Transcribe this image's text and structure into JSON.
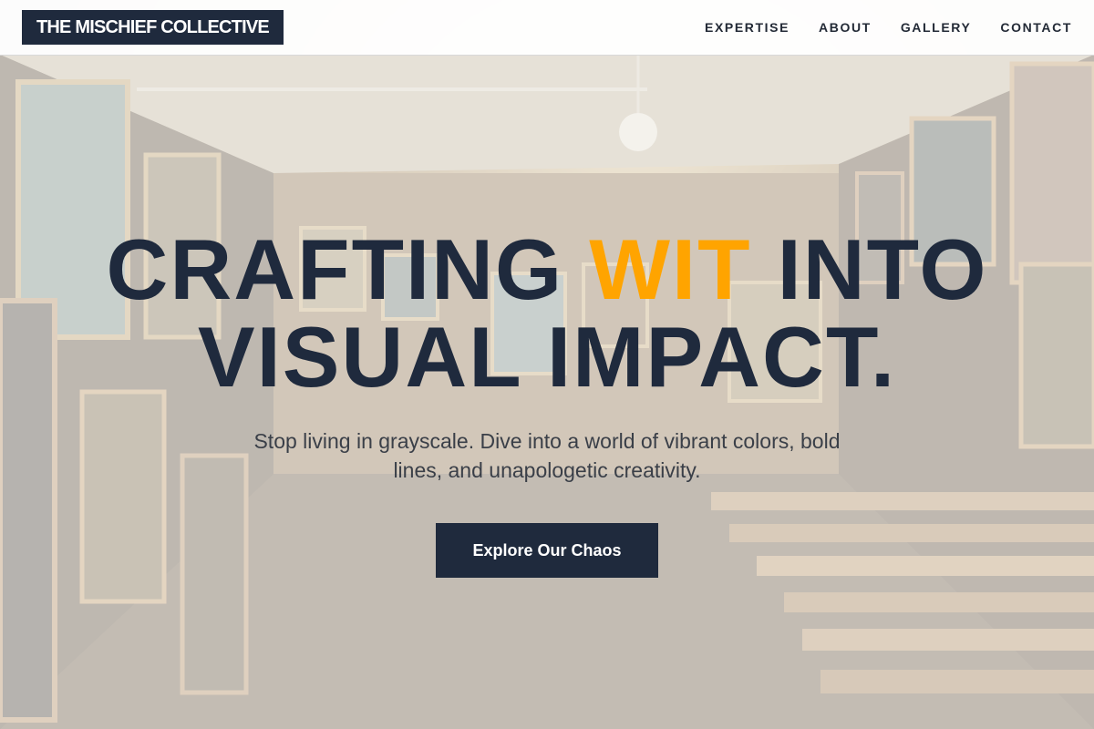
{
  "brand": {
    "name": "THE MISCHIEF COLLECTIVE"
  },
  "nav": {
    "items": [
      {
        "label": "EXPERTISE"
      },
      {
        "label": "ABOUT"
      },
      {
        "label": "GALLERY"
      },
      {
        "label": "CONTACT"
      }
    ]
  },
  "hero": {
    "headline_part1": "CRAFTING ",
    "headline_accent": "WIT",
    "headline_part2": " INTO",
    "headline_line2": "VISUAL IMPACT.",
    "subhead": "Stop living in grayscale. Dive into a world of vibrant colors, bold lines, and unapologetic creativity.",
    "cta_label": "Explore Our Chaos",
    "background_image": "art-gallery-corridor-photo"
  },
  "colors": {
    "navy": "#1f2a3d",
    "accent": "#ffa400",
    "header_bg": "#ffffff",
    "text_muted": "#3a3f48"
  }
}
